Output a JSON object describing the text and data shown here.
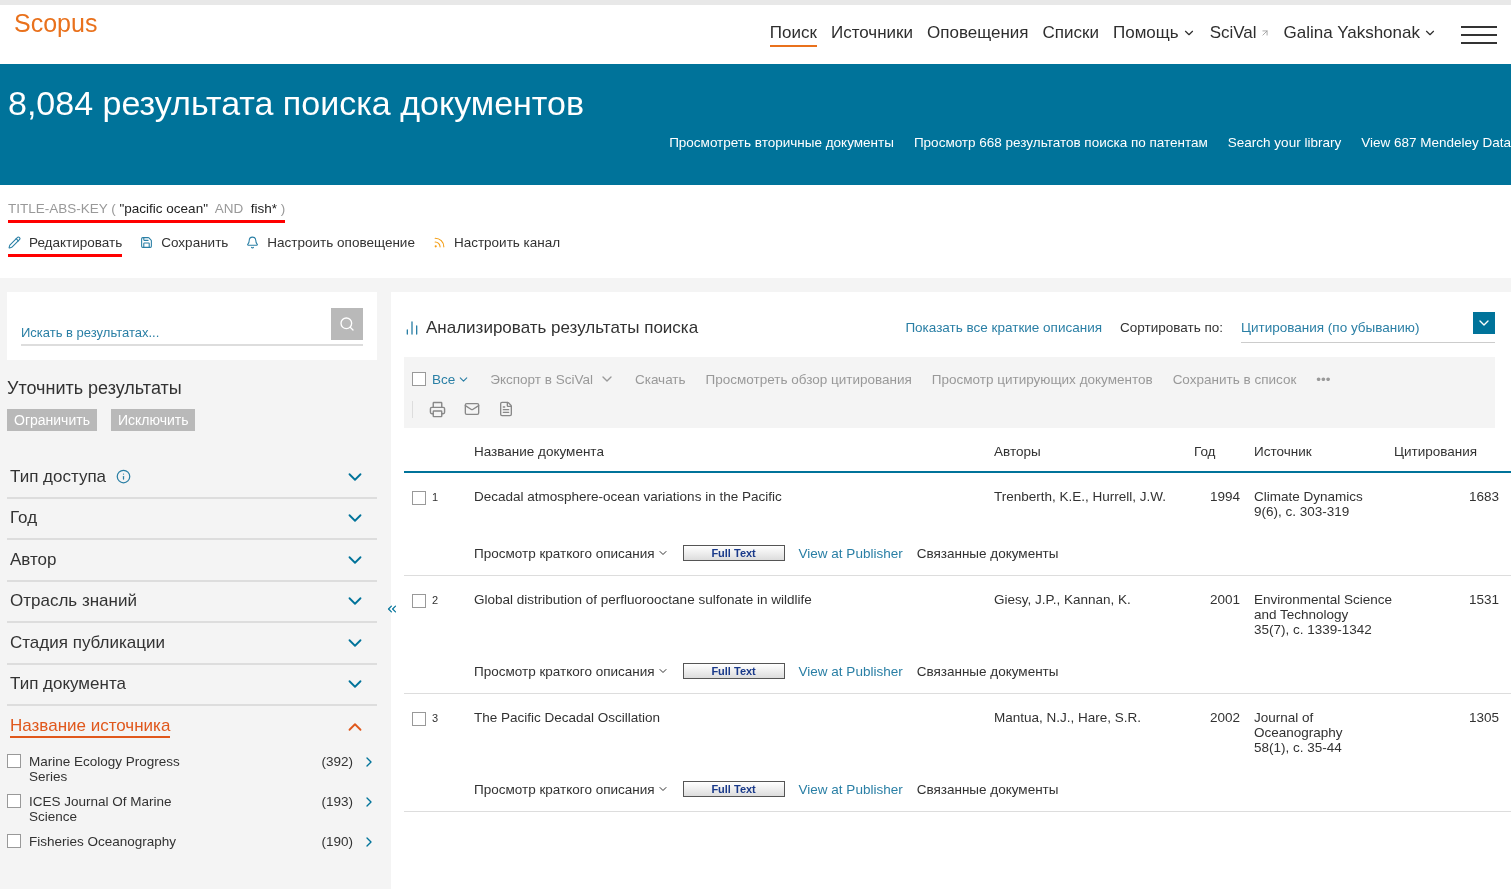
{
  "brand": "Scopus",
  "nav": [
    {
      "label": "Поиск",
      "selected": true,
      "kind": "link"
    },
    {
      "label": "Источники",
      "selected": false,
      "kind": "link"
    },
    {
      "label": "Оповещения",
      "selected": false,
      "kind": "link"
    },
    {
      "label": "Списки",
      "selected": false,
      "kind": "link"
    },
    {
      "label": "Помощь",
      "selected": false,
      "kind": "dropdown"
    },
    {
      "label": "SciVal",
      "selected": false,
      "kind": "external"
    },
    {
      "label": "Galina Yakshonak",
      "selected": false,
      "kind": "dropdown"
    }
  ],
  "banner": {
    "title": "8,084 результата поиска документов",
    "links": [
      "Просмотреть вторичные документы",
      "Просмотр 668 результатов поиска по патентам",
      "Search your library",
      "View 687 Mendeley Data"
    ]
  },
  "query": {
    "field": "TITLE-ABS-KEY (",
    "term1": "\"pacific ocean\"",
    "operator": "AND",
    "term2": "fish*",
    "close": ")",
    "highlighted": true
  },
  "query_actions": [
    {
      "label": "Редактировать",
      "kind": "edit",
      "highlighted": true
    },
    {
      "label": "Сохранить",
      "kind": "save",
      "highlighted": false
    },
    {
      "label": "Настроить оповещение",
      "kind": "alert",
      "highlighted": false
    },
    {
      "label": "Настроить канал",
      "kind": "feed",
      "highlighted": false
    }
  ],
  "sidebar": {
    "search": {
      "placeholder": "Искать в результатах..."
    },
    "refine_title": "Уточнить результаты",
    "buttons": [
      "Ограничить",
      "Исключить"
    ],
    "facets": [
      {
        "label": "Тип доступа",
        "expanded": false,
        "info": true
      },
      {
        "label": "Год",
        "expanded": false,
        "info": false
      },
      {
        "label": "Автор",
        "expanded": false,
        "info": false
      },
      {
        "label": "Отрасль знаний",
        "expanded": false,
        "info": false
      },
      {
        "label": "Стадия публикации",
        "expanded": false,
        "info": false
      },
      {
        "label": "Тип документа",
        "expanded": false,
        "info": false
      },
      {
        "label": "Название источника",
        "expanded": true,
        "info": false,
        "items": [
          {
            "label": "Marine Ecology Progress Series",
            "count": "(392)",
            "checked": false
          },
          {
            "label": "ICES Journal Of Marine Science",
            "count": "(193)",
            "checked": false
          },
          {
            "label": "Fisheries Oceanography",
            "count": "(190)",
            "checked": false
          }
        ]
      }
    ]
  },
  "results": {
    "analyze": "Анализировать результаты поиска",
    "show_abstracts": "Показать все краткие описания",
    "sort_label": "Сортировать по:",
    "sort_value": "Цитирования (по убыванию)",
    "toolbar": {
      "select_all": "Все",
      "select_all_checked": false,
      "actions": [
        "Экспорт в SciVal",
        "Скачать",
        "Просмотреть обзор цитирования",
        "Просмотр цитирующих документов",
        "Сохранить в список"
      ],
      "more": "•••"
    },
    "columns": [
      "Название документа",
      "Авторы",
      "Год",
      "Источник",
      "Цитирования"
    ],
    "rows": [
      {
        "index": "1",
        "checked": false,
        "title": "Decadal atmosphere-ocean variations in the Pacific",
        "authors": "Trenberth, K.E., Hurrell, J.W.",
        "year": "1994",
        "source": "Climate Dynamics",
        "source_detail": "9(6), c. 303-319",
        "citations": "1683",
        "actions": {
          "abstract": "Просмотр краткого описания",
          "full_text": "Full Text",
          "publisher": "View at Publisher",
          "related": "Связанные документы"
        }
      },
      {
        "index": "2",
        "checked": false,
        "title": "Global distribution of perfluorooctane sulfonate in wildlife",
        "authors": "Giesy, J.P., Kannan, K.",
        "year": "2001",
        "source": "Environmental Science and Technology",
        "source_detail": "35(7), c. 1339-1342",
        "citations": "1531",
        "actions": {
          "abstract": "Просмотр краткого описания",
          "full_text": "Full Text",
          "publisher": "View at Publisher",
          "related": "Связанные документы"
        }
      },
      {
        "index": "3",
        "checked": false,
        "title": "The Pacific Decadal Oscillation",
        "authors": "Mantua, N.J., Hare, S.R.",
        "year": "2002",
        "source": "Journal of Oceanography",
        "source_detail": "58(1), c. 35-44",
        "citations": "1305",
        "actions": {
          "abstract": "Просмотр краткого описания",
          "full_text": "Full Text",
          "publisher": "View at Publisher",
          "related": "Связанные документы"
        }
      }
    ]
  }
}
